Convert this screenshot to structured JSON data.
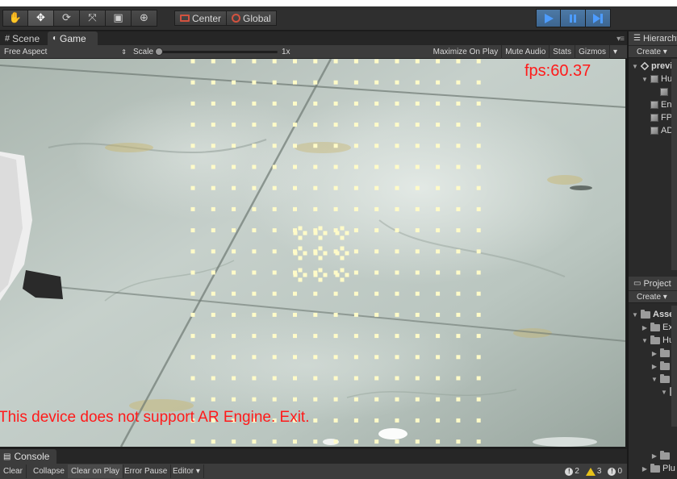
{
  "toolbar": {
    "tools": [
      "hand-tool",
      "move-tool",
      "rotate-tool",
      "scale-tool",
      "rect-tool",
      "transform-tool"
    ],
    "pivot_label": "Center",
    "space_label": "Global",
    "play_buttons": [
      "play",
      "pause",
      "step"
    ]
  },
  "tabs": {
    "scene": "Scene",
    "game": "Game"
  },
  "gamebar": {
    "aspect": "Free Aspect",
    "scale_label": "Scale",
    "scale_value": "1x",
    "maximize": "Maximize On Play",
    "mute": "Mute Audio",
    "stats": "Stats",
    "gizmos": "Gizmos"
  },
  "viewport": {
    "fps": "fps:60.37",
    "error": "This device does not support AR Engine. Exit."
  },
  "hierarchy": {
    "tab": "Hierarchy",
    "create": "Create",
    "items": [
      {
        "label": "previ",
        "depth": 0,
        "arrow": "▼",
        "icon": "unity"
      },
      {
        "label": "Hu",
        "depth": 1,
        "arrow": "▼",
        "icon": "cube"
      },
      {
        "label": "",
        "depth": 2,
        "arrow": "",
        "icon": "cube"
      },
      {
        "label": "En",
        "depth": 1,
        "arrow": "",
        "icon": "cube"
      },
      {
        "label": "FP",
        "depth": 1,
        "arrow": "",
        "icon": "cube"
      },
      {
        "label": "AD",
        "depth": 1,
        "arrow": "",
        "icon": "cube"
      }
    ]
  },
  "project": {
    "tab": "Project",
    "create": "Create",
    "items": [
      {
        "label": "Asse",
        "depth": 0,
        "arrow": "▼"
      },
      {
        "label": "Ex",
        "depth": 1,
        "arrow": "▶"
      },
      {
        "label": "Hu",
        "depth": 1,
        "arrow": "▼"
      },
      {
        "label": "",
        "depth": 2,
        "arrow": "▶"
      },
      {
        "label": "",
        "depth": 2,
        "arrow": "▶"
      },
      {
        "label": "",
        "depth": 2,
        "arrow": "▼"
      },
      {
        "label": "",
        "depth": 3,
        "arrow": "▼"
      }
    ],
    "bottom_items": [
      {
        "label": "",
        "depth": 2,
        "arrow": "▶"
      },
      {
        "label": "Plu",
        "depth": 1,
        "arrow": "▶"
      }
    ]
  },
  "console": {
    "tab": "Console",
    "buttons": [
      "Clear",
      "Collapse",
      "Clear on Play",
      "Error Pause",
      "Editor"
    ],
    "log_count": "2",
    "warning_count": "3",
    "error_count": "0"
  },
  "colors": {
    "overlay_text": "#ff1a1a",
    "play_icon": "#4d9cff",
    "dot": "#fffbc8"
  }
}
